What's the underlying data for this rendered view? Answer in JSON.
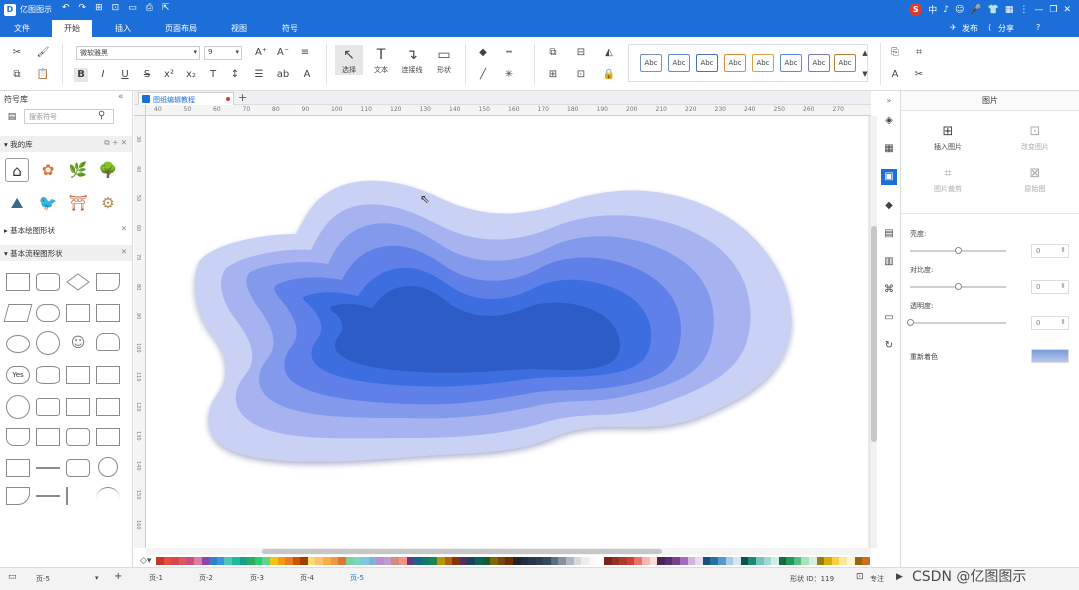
{
  "app": {
    "title": "亿图图示"
  },
  "titlebar": {
    "quick": [
      "↶",
      "↷",
      "⊞",
      "⊡",
      "▭",
      "⎙",
      "⇱"
    ],
    "right": [
      "中",
      "♪",
      "☺",
      "🎤",
      "👕",
      "▦",
      "⋮",
      "—",
      "❐",
      "✕"
    ]
  },
  "menu": {
    "items": [
      "文件",
      "开始",
      "插入",
      "页面布局",
      "视图",
      "符号"
    ],
    "active": "开始",
    "publish": "发布",
    "share": "分享",
    "help": "?"
  },
  "ribbon": {
    "font_name": "微软雅黑",
    "font_size": "9",
    "select_label": "选择",
    "text_label": "文本",
    "connector_label": "连接线",
    "shape_label": "形状",
    "style_preview_label": "Abc",
    "style_border_colors": [
      "#7b8fc4",
      "#6a86d6",
      "#4a6fb5",
      "#e08a3c",
      "#d8a040",
      "#5a8ad8",
      "#7a7ac0",
      "#c07a3a"
    ]
  },
  "left_panel": {
    "title": "符号库",
    "search_placeholder": "搜索符号",
    "my_lib": "我的库",
    "basic_shapes": "基本绘图形状",
    "flow_shapes": "基本流程图形状",
    "yes_shape_label": "Yes",
    "lib_icons": [
      "⌂",
      "✿",
      "🌿",
      "🌳",
      "⛰",
      "🐦",
      "⛩",
      "⚙"
    ]
  },
  "document": {
    "tab_name": "图纸编辑教程"
  },
  "rulers": {
    "h_ticks": [
      "40",
      "50",
      "60",
      "70",
      "80",
      "90",
      "100",
      "110",
      "120",
      "130",
      "140",
      "150",
      "160",
      "170",
      "180",
      "190",
      "200",
      "210",
      "220",
      "230",
      "240",
      "250",
      "260",
      "270"
    ],
    "v_ticks": [
      "30",
      "40",
      "50",
      "60",
      "70",
      "80",
      "90",
      "100",
      "110",
      "120",
      "130",
      "140",
      "150",
      "160"
    ]
  },
  "canvas": {
    "layer_colors": [
      "#c9d1f5",
      "#a6b3f0",
      "#8399ec",
      "#5f80e8",
      "#3d6ee0",
      "#2f5cc6"
    ]
  },
  "palette": {
    "colors": [
      "#c0392b",
      "#e74c3c",
      "#d64550",
      "#e25858",
      "#c94f7c",
      "#e07aa0",
      "#8e44ad",
      "#2e86c1",
      "#3498db",
      "#48c9b0",
      "#1abc9c",
      "#16a085",
      "#27ae60",
      "#2ecc71",
      "#58d68d",
      "#f1c40f",
      "#f39c12",
      "#e67e22",
      "#d35400",
      "#a04000",
      "#f7dc6f",
      "#f8c471",
      "#f5b041",
      "#eb984e",
      "#dc7633",
      "#7dcea0",
      "#76d7c4",
      "#85c1e9",
      "#7fb3d5",
      "#bb8fce",
      "#c39bd3",
      "#d98880",
      "#f1948a",
      "#6c3483",
      "#1f618d",
      "#117864",
      "#1e8449",
      "#b7950b",
      "#af601a",
      "#873600",
      "#512e5f",
      "#154360",
      "#0e6251",
      "#145a32",
      "#7d6608",
      "#784212",
      "#6e2c00",
      "#1b2631",
      "#212f3d",
      "#273746",
      "#2c3e50",
      "#34495e",
      "#5d6d7e",
      "#85929e",
      "#aeb6bf",
      "#d5d8dc",
      "#ebedef",
      "#f8f9f9",
      "#fdfefe",
      "#7b241c",
      "#943126",
      "#b03a2e",
      "#cb4335",
      "#ec7063",
      "#f5b7b1",
      "#fadbd8",
      "#4a235a",
      "#5b2c6f",
      "#76448a",
      "#a569bd",
      "#d2b4de",
      "#e8daef",
      "#1a5276",
      "#2471a3",
      "#5499c7",
      "#a9cce3",
      "#d4e6f1",
      "#0b5345",
      "#138d75",
      "#73c6b6",
      "#a2d9ce",
      "#d0ece7",
      "#186a3b",
      "#229954",
      "#52be80",
      "#a9dfbf",
      "#d4efdf",
      "#9a7d0a",
      "#d4ac0d",
      "#f4d03f",
      "#f9e79f",
      "#fcf3cf",
      "#9c640c",
      "#ca6f1e",
      "#ebcb8b",
      "#222222",
      "#444444",
      "#666666",
      "#888888",
      "#aaaaaa",
      "#cccccc",
      "#eeeeee",
      "#ffffff"
    ]
  },
  "right_panel": {
    "title": "图片",
    "insert_image": "插入图片",
    "change_image": "改变图片",
    "crop_image": "图片裁剪",
    "original": "原始图",
    "brightness_label": "亮度:",
    "brightness_value": "0",
    "brightness": 0.5,
    "contrast_label": "对比度:",
    "contrast_value": "0",
    "contrast": 0.5,
    "transparency_label": "透明度:",
    "transparency_value": "0",
    "transparency": 0,
    "recolor_label": "重新着色",
    "side_icons": [
      "◈",
      "▦",
      "▣",
      "◆",
      "▤",
      "▥",
      "⌘",
      "▭",
      "↻"
    ]
  },
  "status": {
    "page_select": "页-5",
    "add_page": "+",
    "pages": [
      "页-1",
      "页-2",
      "页-3",
      "页-4",
      "页-5"
    ],
    "active_page": "页-5",
    "shape_id": "形状 ID：119",
    "focus": "专注",
    "watermark": "CSDN @亿图图示"
  }
}
